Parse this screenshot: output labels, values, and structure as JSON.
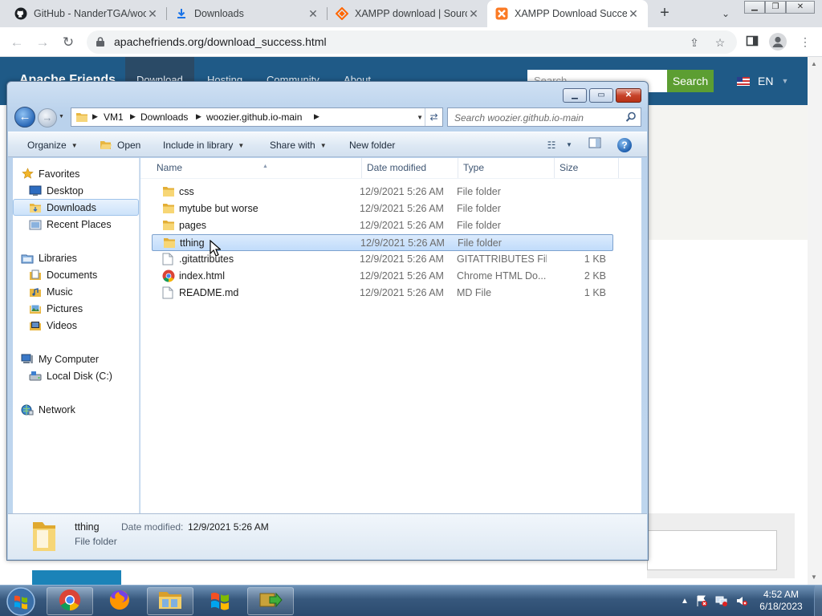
{
  "browser": {
    "tabs": [
      {
        "title": "GitHub - NanderTGA/woozier",
        "active": false
      },
      {
        "title": "Downloads",
        "active": false
      },
      {
        "title": "XAMPP download | SourceForge",
        "active": false
      },
      {
        "title": "XAMPP Download Success",
        "active": true
      }
    ],
    "new_tab": "+",
    "url": "apachefriends.org/download_success.html"
  },
  "site": {
    "logo": "Apache Friends",
    "nav": [
      "Download",
      "Hosting",
      "Community",
      "About"
    ],
    "search_placeholder": "Search...",
    "search_button": "Search",
    "language": "EN"
  },
  "explorer": {
    "breadcrumb": [
      "VM1",
      "Downloads",
      "woozier.github.io-main"
    ],
    "search_placeholder": "Search woozier.github.io-main",
    "commands": {
      "organize": "Organize",
      "open": "Open",
      "include_in_library": "Include in library",
      "share_with": "Share with",
      "new_folder": "New folder"
    },
    "nav": {
      "favorites": "Favorites",
      "desktop": "Desktop",
      "downloads": "Downloads",
      "recent_places": "Recent Places",
      "libraries": "Libraries",
      "documents": "Documents",
      "music": "Music",
      "pictures": "Pictures",
      "videos": "Videos",
      "my_computer": "My Computer",
      "local_disk": "Local Disk (C:)",
      "network": "Network"
    },
    "columns": {
      "name": "Name",
      "date_modified": "Date modified",
      "type": "Type",
      "size": "Size"
    },
    "files": [
      {
        "name": "css",
        "date": "12/9/2021 5:26 AM",
        "type": "File folder",
        "size": "",
        "icon": "folder-icon"
      },
      {
        "name": "mytube but worse",
        "date": "12/9/2021 5:26 AM",
        "type": "File folder",
        "size": "",
        "icon": "folder-icon"
      },
      {
        "name": "pages",
        "date": "12/9/2021 5:26 AM",
        "type": "File folder",
        "size": "",
        "icon": "folder-icon"
      },
      {
        "name": "tthing",
        "date": "12/9/2021 5:26 AM",
        "type": "File folder",
        "size": "",
        "icon": "folder-icon",
        "selected": true
      },
      {
        "name": ".gitattributes",
        "date": "12/9/2021 5:26 AM",
        "type": "GITATTRIBUTES File",
        "size": "1 KB",
        "icon": "file-icon"
      },
      {
        "name": "index.html",
        "date": "12/9/2021 5:26 AM",
        "type": "Chrome HTML Do...",
        "size": "2 KB",
        "icon": "chrome-icon"
      },
      {
        "name": "README.md",
        "date": "12/9/2021 5:26 AM",
        "type": "MD File",
        "size": "1 KB",
        "icon": "file-icon"
      }
    ],
    "details": {
      "name": "tthing",
      "type": "File folder",
      "date_label": "Date modified:",
      "date_value": "12/9/2021 5:26 AM"
    }
  },
  "taskbar": {
    "time": "4:52 AM",
    "date": "6/18/2023"
  },
  "colors": {
    "site_header": "#1f5a87",
    "search_green": "#5c9e32",
    "selection_blue": "#c1dcfb",
    "taskbar": "#2b4a6e"
  }
}
